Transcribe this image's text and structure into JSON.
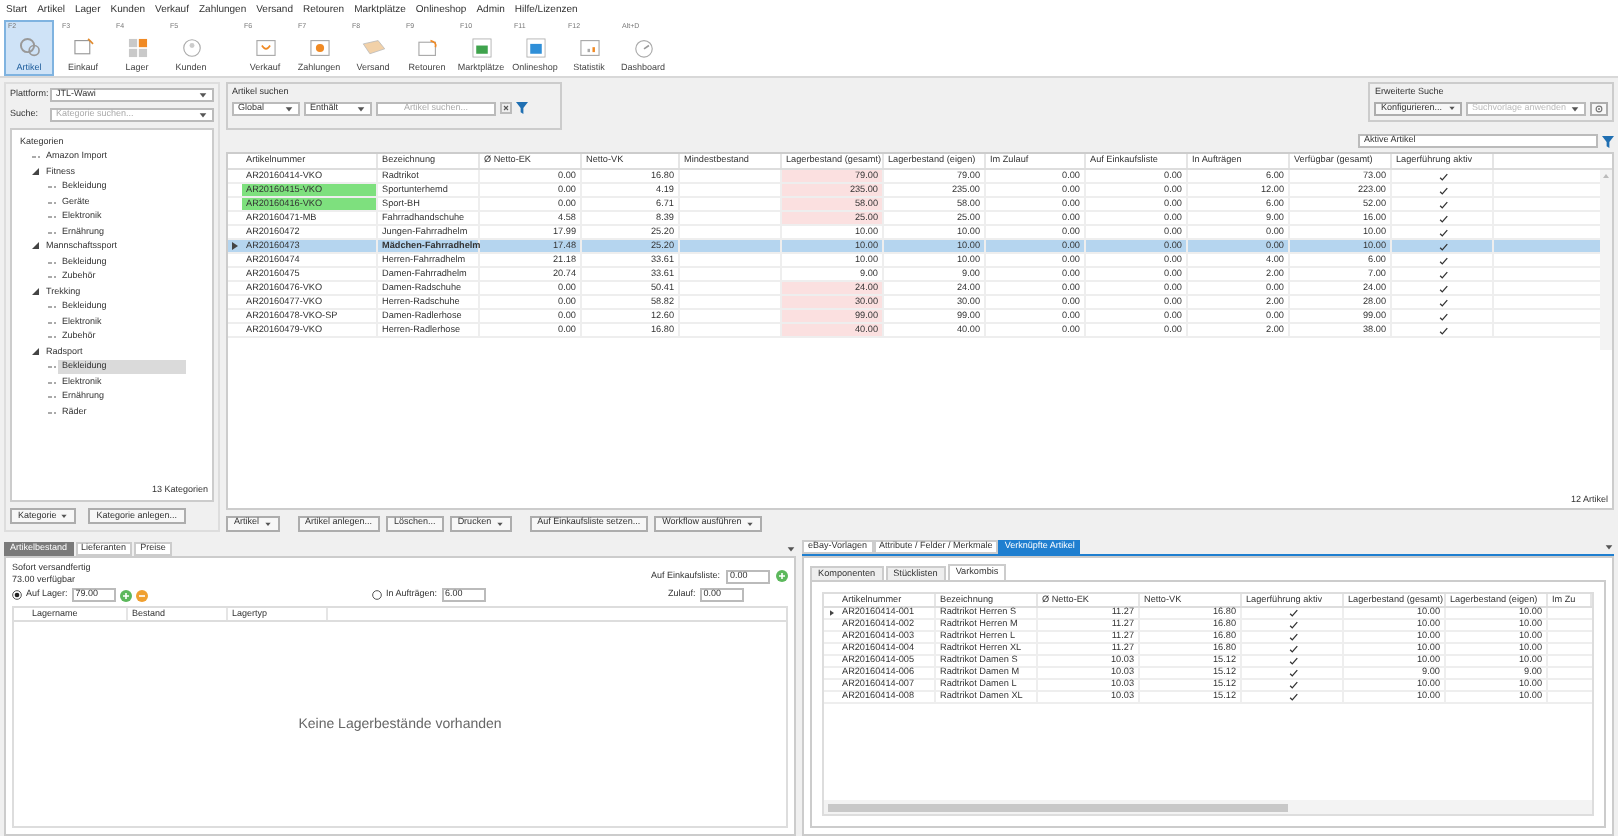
{
  "menu": [
    "Start",
    "Artikel",
    "Lager",
    "Kunden",
    "Verkauf",
    "Zahlungen",
    "Versand",
    "Retouren",
    "Marktplätze",
    "Onlineshop",
    "Admin",
    "Hilfe/Lizenzen"
  ],
  "toolbar": [
    {
      "key": "F2",
      "label": "Artikel",
      "kind": "artikel",
      "selected": true
    },
    {
      "key": "F3",
      "label": "Einkauf",
      "kind": "einkauf",
      "selected": false
    },
    {
      "key": "F4",
      "label": "Lager",
      "kind": "lager",
      "selected": false
    },
    {
      "key": "F5",
      "label": "Kunden",
      "kind": "kunden",
      "selected": false
    },
    {
      "key": "F6",
      "label": "Verkauf",
      "kind": "verkauf",
      "selected": false
    },
    {
      "key": "F7",
      "label": "Zahlungen",
      "kind": "zahlungen",
      "selected": false
    },
    {
      "key": "F8",
      "label": "Versand",
      "kind": "versand",
      "selected": false
    },
    {
      "key": "F9",
      "label": "Retouren",
      "kind": "retouren",
      "selected": false
    },
    {
      "key": "F10",
      "label": "Marktplätze",
      "kind": "markt",
      "selected": false
    },
    {
      "key": "F11",
      "label": "Onlineshop",
      "kind": "shop",
      "selected": false
    },
    {
      "key": "F12",
      "label": "Statistik",
      "kind": "statistik",
      "selected": false
    },
    {
      "key": "Alt+D",
      "label": "Dashboard",
      "kind": "dashboard",
      "selected": false
    }
  ],
  "left_panel": {
    "platform_label": "Plattform:",
    "platform": "JTL-Wawi",
    "search_label": "Suche:",
    "search_placeholder": "Kategorie suchen...",
    "tree": {
      "label": "Kategorien",
      "selected": false,
      "children": [
        {
          "label": "Amazon Import",
          "selected": false
        },
        {
          "label": "Fitness",
          "selected": false,
          "expanded": true,
          "children": [
            {
              "label": "Bekleidung",
              "selected": false
            },
            {
              "label": "Geräte",
              "selected": false
            },
            {
              "label": "Elektronik",
              "selected": false
            },
            {
              "label": "Ernährung",
              "selected": false
            }
          ]
        },
        {
          "label": "Mannschaftssport",
          "selected": false,
          "expanded": true,
          "children": [
            {
              "label": "Bekleidung",
              "selected": false
            },
            {
              "label": "Zubehör",
              "selected": false
            }
          ]
        },
        {
          "label": "Trekking",
          "selected": false,
          "expanded": true,
          "children": [
            {
              "label": "Bekleidung",
              "selected": false
            },
            {
              "label": "Elektronik",
              "selected": false
            },
            {
              "label": "Zubehör",
              "selected": false
            }
          ]
        },
        {
          "label": "Radsport",
          "selected": false,
          "expanded": true,
          "children": [
            {
              "label": "Bekleidung",
              "selected": true
            },
            {
              "label": "Elektronik",
              "selected": false
            },
            {
              "label": "Ernährung",
              "selected": false
            },
            {
              "label": "Räder",
              "selected": false
            }
          ]
        }
      ]
    },
    "count": "13 Kategorien",
    "buttons": [
      {
        "label": "Kategorie",
        "dropdown": true
      },
      {
        "label": "Kategorie anlegen...",
        "dropdown": false
      }
    ]
  },
  "search": {
    "title": "Artikel suchen",
    "scope": "Global",
    "mode": "Enthält",
    "placeholder": "Artikel suchen..."
  },
  "advanced_search": {
    "title": "Erweiterte Suche",
    "configure": "Konfigurieren...",
    "template_placeholder": "Suchvorlage anwenden"
  },
  "filter": "Aktive Artikel",
  "table": {
    "columns": [
      "Artikelnummer",
      "Bezeichnung",
      "Ø Netto-EK",
      "Netto-VK",
      "Mindestbestand",
      "Lagerbestand (gesamt)",
      "Lagerbestand (eigen)",
      "Im Zulauf",
      "Auf Einkaufsliste",
      "In Aufträgen",
      "Verfügbar (gesamt)",
      "Lagerführung aktiv"
    ],
    "rows": [
      {
        "cells": [
          "AR20160414-VKO",
          "Radtrikot",
          "0.00",
          "16.80",
          "",
          "79.00",
          "79.00",
          "0.00",
          "0.00",
          "6.00",
          "73.00"
        ],
        "stock_managed": true,
        "selected": false,
        "marked": false,
        "low_stock": true
      },
      {
        "cells": [
          "AR20160415-VKO",
          "Sportunterhemd",
          "0.00",
          "4.19",
          "",
          "235.00",
          "235.00",
          "0.00",
          "0.00",
          "12.00",
          "223.00"
        ],
        "stock_managed": true,
        "selected": false,
        "marked": true,
        "low_stock": true
      },
      {
        "cells": [
          "AR20160416-VKO",
          "Sport-BH",
          "0.00",
          "6.71",
          "",
          "58.00",
          "58.00",
          "0.00",
          "0.00",
          "6.00",
          "52.00"
        ],
        "stock_managed": true,
        "selected": false,
        "marked": true,
        "low_stock": true
      },
      {
        "cells": [
          "AR20160471-MB",
          "Fahrradhandschuhe",
          "4.58",
          "8.39",
          "",
          "25.00",
          "25.00",
          "0.00",
          "0.00",
          "9.00",
          "16.00"
        ],
        "stock_managed": true,
        "selected": false,
        "marked": false,
        "low_stock": true
      },
      {
        "cells": [
          "AR20160472",
          "Jungen-Fahrradhelm",
          "17.99",
          "25.20",
          "",
          "10.00",
          "10.00",
          "0.00",
          "0.00",
          "0.00",
          "10.00"
        ],
        "stock_managed": true,
        "selected": false,
        "marked": false,
        "low_stock": false
      },
      {
        "cells": [
          "AR20160473",
          "Mädchen-Fahrradhelm",
          "17.48",
          "25.20",
          "",
          "10.00",
          "10.00",
          "0.00",
          "0.00",
          "0.00",
          "10.00"
        ],
        "stock_managed": true,
        "selected": true,
        "marked": false,
        "low_stock": false
      },
      {
        "cells": [
          "AR20160474",
          "Herren-Fahrradhelm",
          "21.18",
          "33.61",
          "",
          "10.00",
          "10.00",
          "0.00",
          "0.00",
          "4.00",
          "6.00"
        ],
        "stock_managed": true,
        "selected": false,
        "marked": false,
        "low_stock": false
      },
      {
        "cells": [
          "AR20160475",
          "Damen-Fahrradhelm",
          "20.74",
          "33.61",
          "",
          "9.00",
          "9.00",
          "0.00",
          "0.00",
          "2.00",
          "7.00"
        ],
        "stock_managed": true,
        "selected": false,
        "marked": false,
        "low_stock": false
      },
      {
        "cells": [
          "AR20160476-VKO",
          "Damen-Radschuhe",
          "0.00",
          "50.41",
          "",
          "24.00",
          "24.00",
          "0.00",
          "0.00",
          "0.00",
          "24.00"
        ],
        "stock_managed": true,
        "selected": false,
        "marked": false,
        "low_stock": true
      },
      {
        "cells": [
          "AR20160477-VKO",
          "Herren-Radschuhe",
          "0.00",
          "58.82",
          "",
          "30.00",
          "30.00",
          "0.00",
          "0.00",
          "2.00",
          "28.00"
        ],
        "stock_managed": true,
        "selected": false,
        "marked": false,
        "low_stock": true
      },
      {
        "cells": [
          "AR20160478-VKO-SP",
          "Damen-Radlerhose",
          "0.00",
          "12.60",
          "",
          "99.00",
          "99.00",
          "0.00",
          "0.00",
          "0.00",
          "99.00"
        ],
        "stock_managed": true,
        "selected": false,
        "marked": false,
        "low_stock": true
      },
      {
        "cells": [
          "AR20160479-VKO",
          "Herren-Radlerhose",
          "0.00",
          "16.80",
          "",
          "40.00",
          "40.00",
          "0.00",
          "0.00",
          "2.00",
          "38.00"
        ],
        "stock_managed": true,
        "selected": false,
        "marked": false,
        "low_stock": true
      }
    ],
    "count": "12 Artikel"
  },
  "actions": [
    {
      "label": "Artikel",
      "dropdown": true
    },
    {
      "label": "Artikel anlegen...",
      "dropdown": false
    },
    {
      "label": "Löschen...",
      "dropdown": false
    },
    {
      "label": "Drucken",
      "dropdown": true
    },
    {
      "label": "Auf Einkaufsliste setzen...",
      "dropdown": false
    },
    {
      "label": "Workflow ausführen",
      "dropdown": true
    }
  ],
  "stock_panel": {
    "tabs": [
      {
        "label": "Artikelbestand",
        "selected": true
      },
      {
        "label": "Lieferanten",
        "selected": false
      },
      {
        "label": "Preise",
        "selected": false
      }
    ],
    "status": "Sofort versandfertig",
    "available": "73.00 verfügbar",
    "on_order_list": {
      "label": "Auf Einkaufsliste:",
      "value": "0.00"
    },
    "fields": [
      {
        "kind": "radio",
        "label": "Auf Lager:",
        "value": "79.00",
        "selected": true
      },
      {
        "kind": "radio",
        "label": "In Aufträgen:",
        "value": "6.00",
        "selected": false
      },
      {
        "kind": "plain",
        "label": "Zulauf:",
        "value": "0.00"
      }
    ],
    "columns": [
      "Lagername",
      "Bestand",
      "Lagertyp"
    ],
    "empty": "Keine Lagerbestände vorhanden"
  },
  "linked_panel": {
    "tabs": [
      {
        "label": "eBay-Vorlagen",
        "selected": false
      },
      {
        "label": "Attribute / Felder / Merkmale",
        "selected": false
      },
      {
        "label": "Verknüpfte Artikel",
        "selected": true
      }
    ],
    "subtabs": [
      {
        "label": "Komponenten",
        "selected": false
      },
      {
        "label": "Stücklisten",
        "selected": false
      },
      {
        "label": "Varkombis",
        "selected": true
      }
    ],
    "columns": [
      "Artikelnummer",
      "Bezeichnung",
      "Ø Netto-EK",
      "Netto-VK",
      "Lagerführung aktiv",
      "Lagerbestand (gesamt)",
      "Lagerbestand (eigen)",
      "Im Zu"
    ],
    "rows": [
      {
        "current": true,
        "stock_managed": true,
        "cells": [
          "AR20160414-001",
          "Radtrikot Herren S",
          "11.27",
          "16.80",
          "",
          "10.00",
          "10.00"
        ]
      },
      {
        "current": false,
        "stock_managed": true,
        "cells": [
          "AR20160414-002",
          "Radtrikot Herren M",
          "11.27",
          "16.80",
          "",
          "10.00",
          "10.00"
        ]
      },
      {
        "current": false,
        "stock_managed": true,
        "cells": [
          "AR20160414-003",
          "Radtrikot Herren L",
          "11.27",
          "16.80",
          "",
          "10.00",
          "10.00"
        ]
      },
      {
        "current": false,
        "stock_managed": true,
        "cells": [
          "AR20160414-004",
          "Radtrikot Herren XL",
          "11.27",
          "16.80",
          "",
          "10.00",
          "10.00"
        ]
      },
      {
        "current": false,
        "stock_managed": true,
        "cells": [
          "AR20160414-005",
          "Radtrikot Damen S",
          "10.03",
          "15.12",
          "",
          "10.00",
          "10.00"
        ]
      },
      {
        "current": false,
        "stock_managed": true,
        "cells": [
          "AR20160414-006",
          "Radtrikot Damen M",
          "10.03",
          "15.12",
          "",
          "9.00",
          "9.00"
        ]
      },
      {
        "current": false,
        "stock_managed": true,
        "cells": [
          "AR20160414-007",
          "Radtrikot Damen L",
          "10.03",
          "15.12",
          "",
          "10.00",
          "10.00"
        ]
      },
      {
        "current": false,
        "stock_managed": true,
        "cells": [
          "AR20160414-008",
          "Radtrikot Damen XL",
          "10.03",
          "15.12",
          "",
          "10.00",
          "10.00"
        ]
      }
    ]
  }
}
